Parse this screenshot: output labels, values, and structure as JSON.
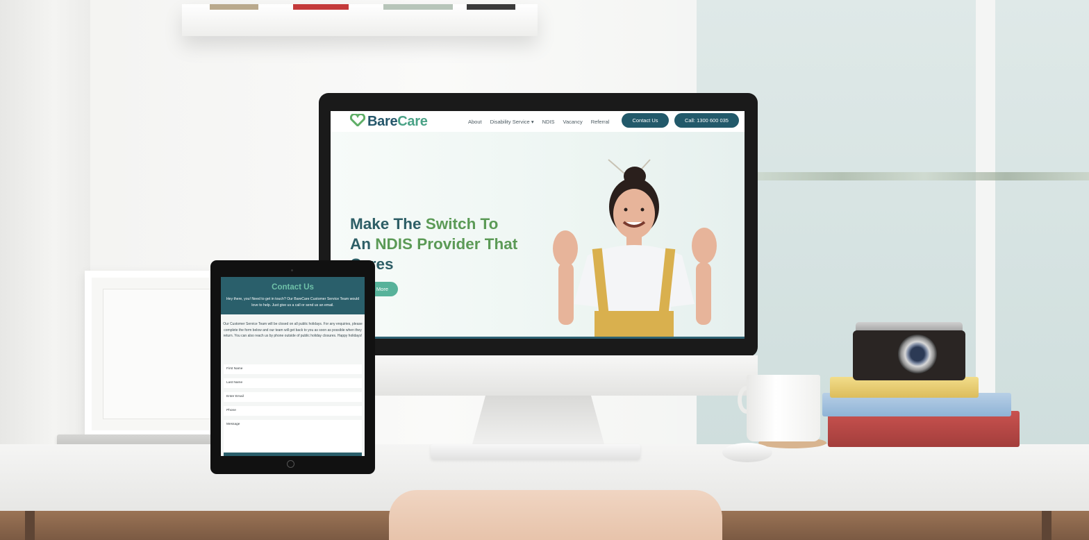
{
  "site": {
    "logo": {
      "bare": "Bare",
      "care": "Care",
      "icon": "heart-icon"
    },
    "nav": {
      "items": [
        "About",
        "Disability Service",
        "NDIS",
        "Vacancy",
        "Referral"
      ],
      "dropdown_caret": "▾",
      "contact_button": "Contact Us",
      "call_button": "Call: 1300 600 035"
    },
    "hero": {
      "title_part1": "Make The ",
      "title_part2": "Switch To",
      "title_part3": "An ",
      "title_part4": "NDIS Provider That",
      "title_part5": "Cares",
      "button_label": "More"
    }
  },
  "tablet": {
    "contact": {
      "title": "Contact Us",
      "subtitle": "Hey there, you! Need to get in touch? Our BareCare Customer Service Team would love to help. Just give us a call or send us an email.",
      "notice": "Our Customer Service Team will be closed on all public holidays. For any enquiries, please complete the form below and our team will get back to you as soon as possible when they return. You can also reach us by phone outside of public holiday closures. Happy holidays!",
      "fields": {
        "first_name": "First Name",
        "last_name": "Last Name",
        "email": "Enter Email",
        "phone": "Phone",
        "message": "Message"
      }
    }
  },
  "colors": {
    "brand_dark": "#22596a",
    "brand_green": "#5b9a56",
    "brand_teal": "#57b29a"
  }
}
